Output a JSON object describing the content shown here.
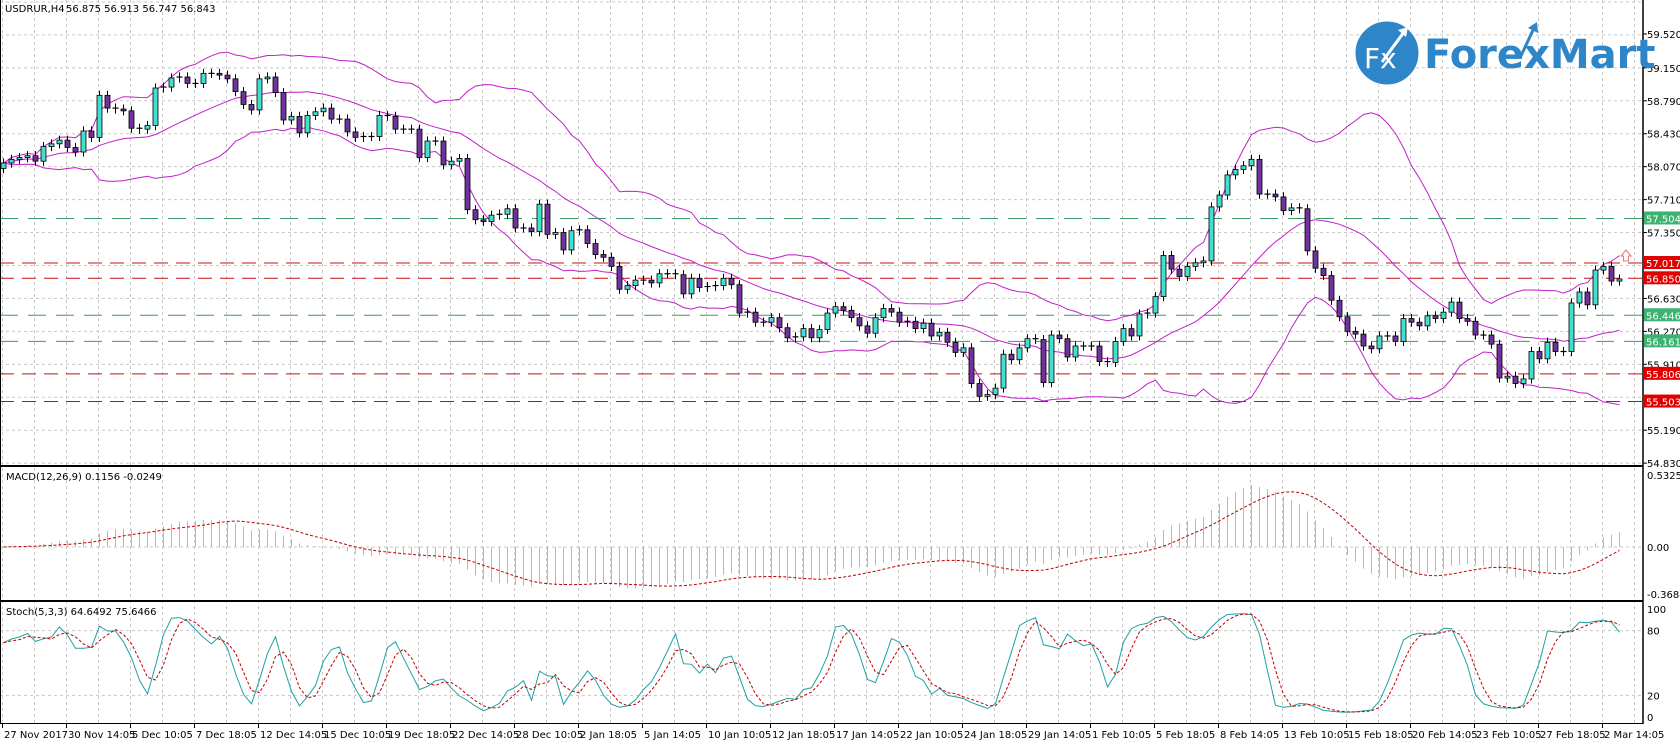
{
  "header": {
    "symbol": "USDRUR,H4",
    "ohlc": "56.875 56.913 56.747 56.843"
  },
  "logo": {
    "fx": "Fx",
    "text": "ForexMart"
  },
  "macd_header": "MACD(12,26,9) 0.1156 -0.0249",
  "stoch_header": "Stoch(5,3,3) 64.6492 75.6466",
  "colors": {
    "bull": "#40e0d0",
    "bear": "#7030a0",
    "bands": "#c020c8",
    "level_red": "#e00000",
    "level_green": "#3cb371",
    "stoch_main": "#20a0a0",
    "signal": "#c00000",
    "histogram": "#b8b8b8",
    "logo": "#2e86c9"
  },
  "chart_data": {
    "type": "candlestick",
    "title": "USDRUR,H4",
    "timeframe": "H4",
    "first_open": 58.05,
    "closes": [
      58.11,
      58.15,
      58.17,
      58.19,
      58.13,
      58.29,
      58.32,
      58.36,
      58.28,
      58.23,
      58.46,
      58.39,
      58.85,
      58.71,
      58.7,
      58.68,
      58.49,
      58.48,
      58.52,
      58.93,
      58.94,
      59.04,
      59.05,
      58.98,
      58.98,
      59.09,
      59.09,
      59.07,
      59.03,
      58.89,
      58.75,
      58.69,
      59.03,
      59.05,
      58.88,
      58.58,
      58.62,
      58.44,
      58.63,
      58.67,
      58.71,
      58.59,
      58.59,
      58.45,
      58.39,
      58.4,
      58.4,
      58.63,
      58.62,
      58.48,
      58.48,
      58.48,
      58.17,
      58.35,
      58.35,
      58.09,
      58.13,
      58.16,
      57.6,
      57.49,
      57.47,
      57.54,
      57.55,
      57.61,
      57.4,
      57.4,
      57.36,
      57.66,
      57.33,
      57.35,
      57.16,
      57.37,
      57.38,
      57.23,
      57.11,
      57.08,
      56.98,
      56.73,
      56.77,
      56.83,
      56.83,
      56.8,
      56.9,
      56.9,
      56.89,
      56.68,
      56.85,
      56.75,
      56.76,
      56.77,
      56.85,
      56.78,
      56.47,
      56.48,
      56.37,
      56.37,
      56.42,
      56.31,
      56.2,
      56.21,
      56.3,
      56.2,
      56.29,
      56.47,
      56.54,
      56.5,
      56.42,
      56.33,
      56.25,
      56.42,
      56.52,
      56.48,
      56.37,
      56.38,
      56.3,
      56.36,
      56.22,
      56.26,
      56.15,
      56.04,
      56.09,
      55.7,
      55.56,
      55.58,
      55.65,
      56.02,
      55.96,
      56.09,
      56.19,
      56.18,
      55.71,
      56.23,
      56.19,
      55.99,
      56.11,
      56.11,
      56.11,
      55.94,
      55.93,
      56.16,
      56.3,
      56.22,
      56.46,
      56.47,
      56.65,
      57.1,
      56.95,
      56.87,
      56.98,
      57.02,
      57.04,
      57.63,
      57.76,
      57.98,
      58.04,
      58.08,
      58.15,
      57.77,
      57.77,
      57.74,
      57.59,
      57.62,
      57.61,
      57.15,
      56.96,
      56.88,
      56.61,
      56.43,
      56.27,
      56.24,
      56.11,
      56.08,
      56.22,
      56.22,
      56.16,
      56.41,
      56.37,
      56.33,
      56.44,
      56.41,
      56.48,
      56.59,
      56.41,
      56.38,
      56.23,
      56.23,
      56.13,
      55.76,
      55.78,
      55.7,
      55.75,
      56.05,
      55.97,
      56.15,
      56.05,
      56.05,
      56.58,
      56.7,
      56.56,
      56.94,
      56.98,
      56.82,
      56.843
    ],
    "indicators": [
      "Bollinger Bands(20,2)",
      "MACD(12,26,9)",
      "Stoch(5,3,3)"
    ],
    "price_axis_labels": [
      "59.520",
      "59.150",
      "58.790",
      "58.430",
      "58.070",
      "57.710",
      "57.350",
      "56.630",
      "56.270",
      "55.910",
      "55.190",
      "54.830"
    ],
    "price_axis_range": [
      54.83,
      59.89
    ],
    "levels": [
      {
        "price": "57.504",
        "color": "green"
      },
      {
        "price": "57.017",
        "color": "red"
      },
      {
        "price": "56.850",
        "color": "red"
      },
      {
        "price": "56.446",
        "color": "green"
      },
      {
        "price": "56.161",
        "color": "green"
      },
      {
        "price": "55.806",
        "color": "red"
      },
      {
        "price": "55.503",
        "color": "red"
      }
    ],
    "macd_axis_labels": [
      "0.5325",
      "0.00",
      "-0.3684"
    ],
    "stoch_axis_labels": [
      "100",
      "80",
      "20",
      "0"
    ],
    "x_labels": [
      "27 Nov 2017",
      "30 Nov 14:05",
      "5 Dec 10:05",
      "7 Dec 18:05",
      "12 Dec 14:05",
      "15 Dec 10:05",
      "19 Dec 18:05",
      "22 Dec 14:05",
      "28 Dec 10:05",
      "2 Jan 18:05",
      "5 Jan 14:05",
      "10 Jan 10:05",
      "12 Jan 18:05",
      "17 Jan 14:05",
      "22 Jan 10:05",
      "24 Jan 18:05",
      "29 Jan 14:05",
      "1 Feb 10:05",
      "5 Feb 18:05",
      "8 Feb 14:05",
      "13 Feb 10:05",
      "15 Feb 18:05",
      "20 Feb 14:05",
      "23 Feb 10:05",
      "27 Feb 18:05",
      "2 Mar 14:05"
    ],
    "grid": true
  }
}
